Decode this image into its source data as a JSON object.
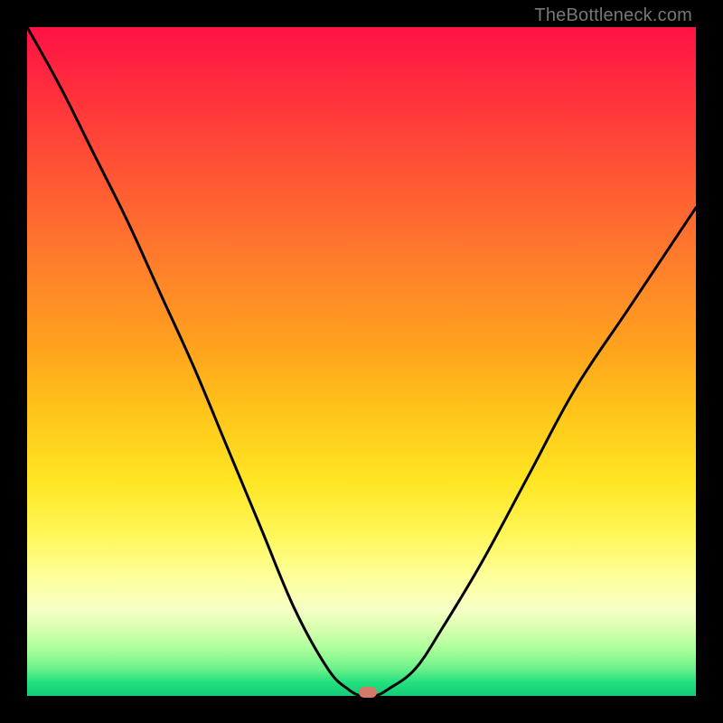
{
  "attribution": "TheBottleneck.com",
  "colors": {
    "curve_stroke": "#000000",
    "marker_fill": "#d47a6a",
    "frame_bg": "#000000"
  },
  "chart_data": {
    "type": "line",
    "title": "",
    "xlabel": "",
    "ylabel": "",
    "xlim": [
      0,
      100
    ],
    "ylim": [
      0,
      100
    ],
    "grid": false,
    "series": [
      {
        "name": "bottleneck-curve",
        "x": [
          0,
          5,
          10,
          15,
          20,
          25,
          30,
          35,
          40,
          45,
          48,
          50,
          52,
          54,
          58,
          62,
          68,
          75,
          82,
          90,
          100
        ],
        "values": [
          100,
          91,
          81,
          71,
          60,
          49,
          37,
          25,
          13,
          4,
          1,
          0,
          0,
          1,
          4,
          10,
          20,
          33,
          46,
          58,
          73
        ]
      }
    ],
    "annotations": [
      {
        "name": "optimal-point-marker",
        "x": 51,
        "y": 0
      }
    ]
  }
}
